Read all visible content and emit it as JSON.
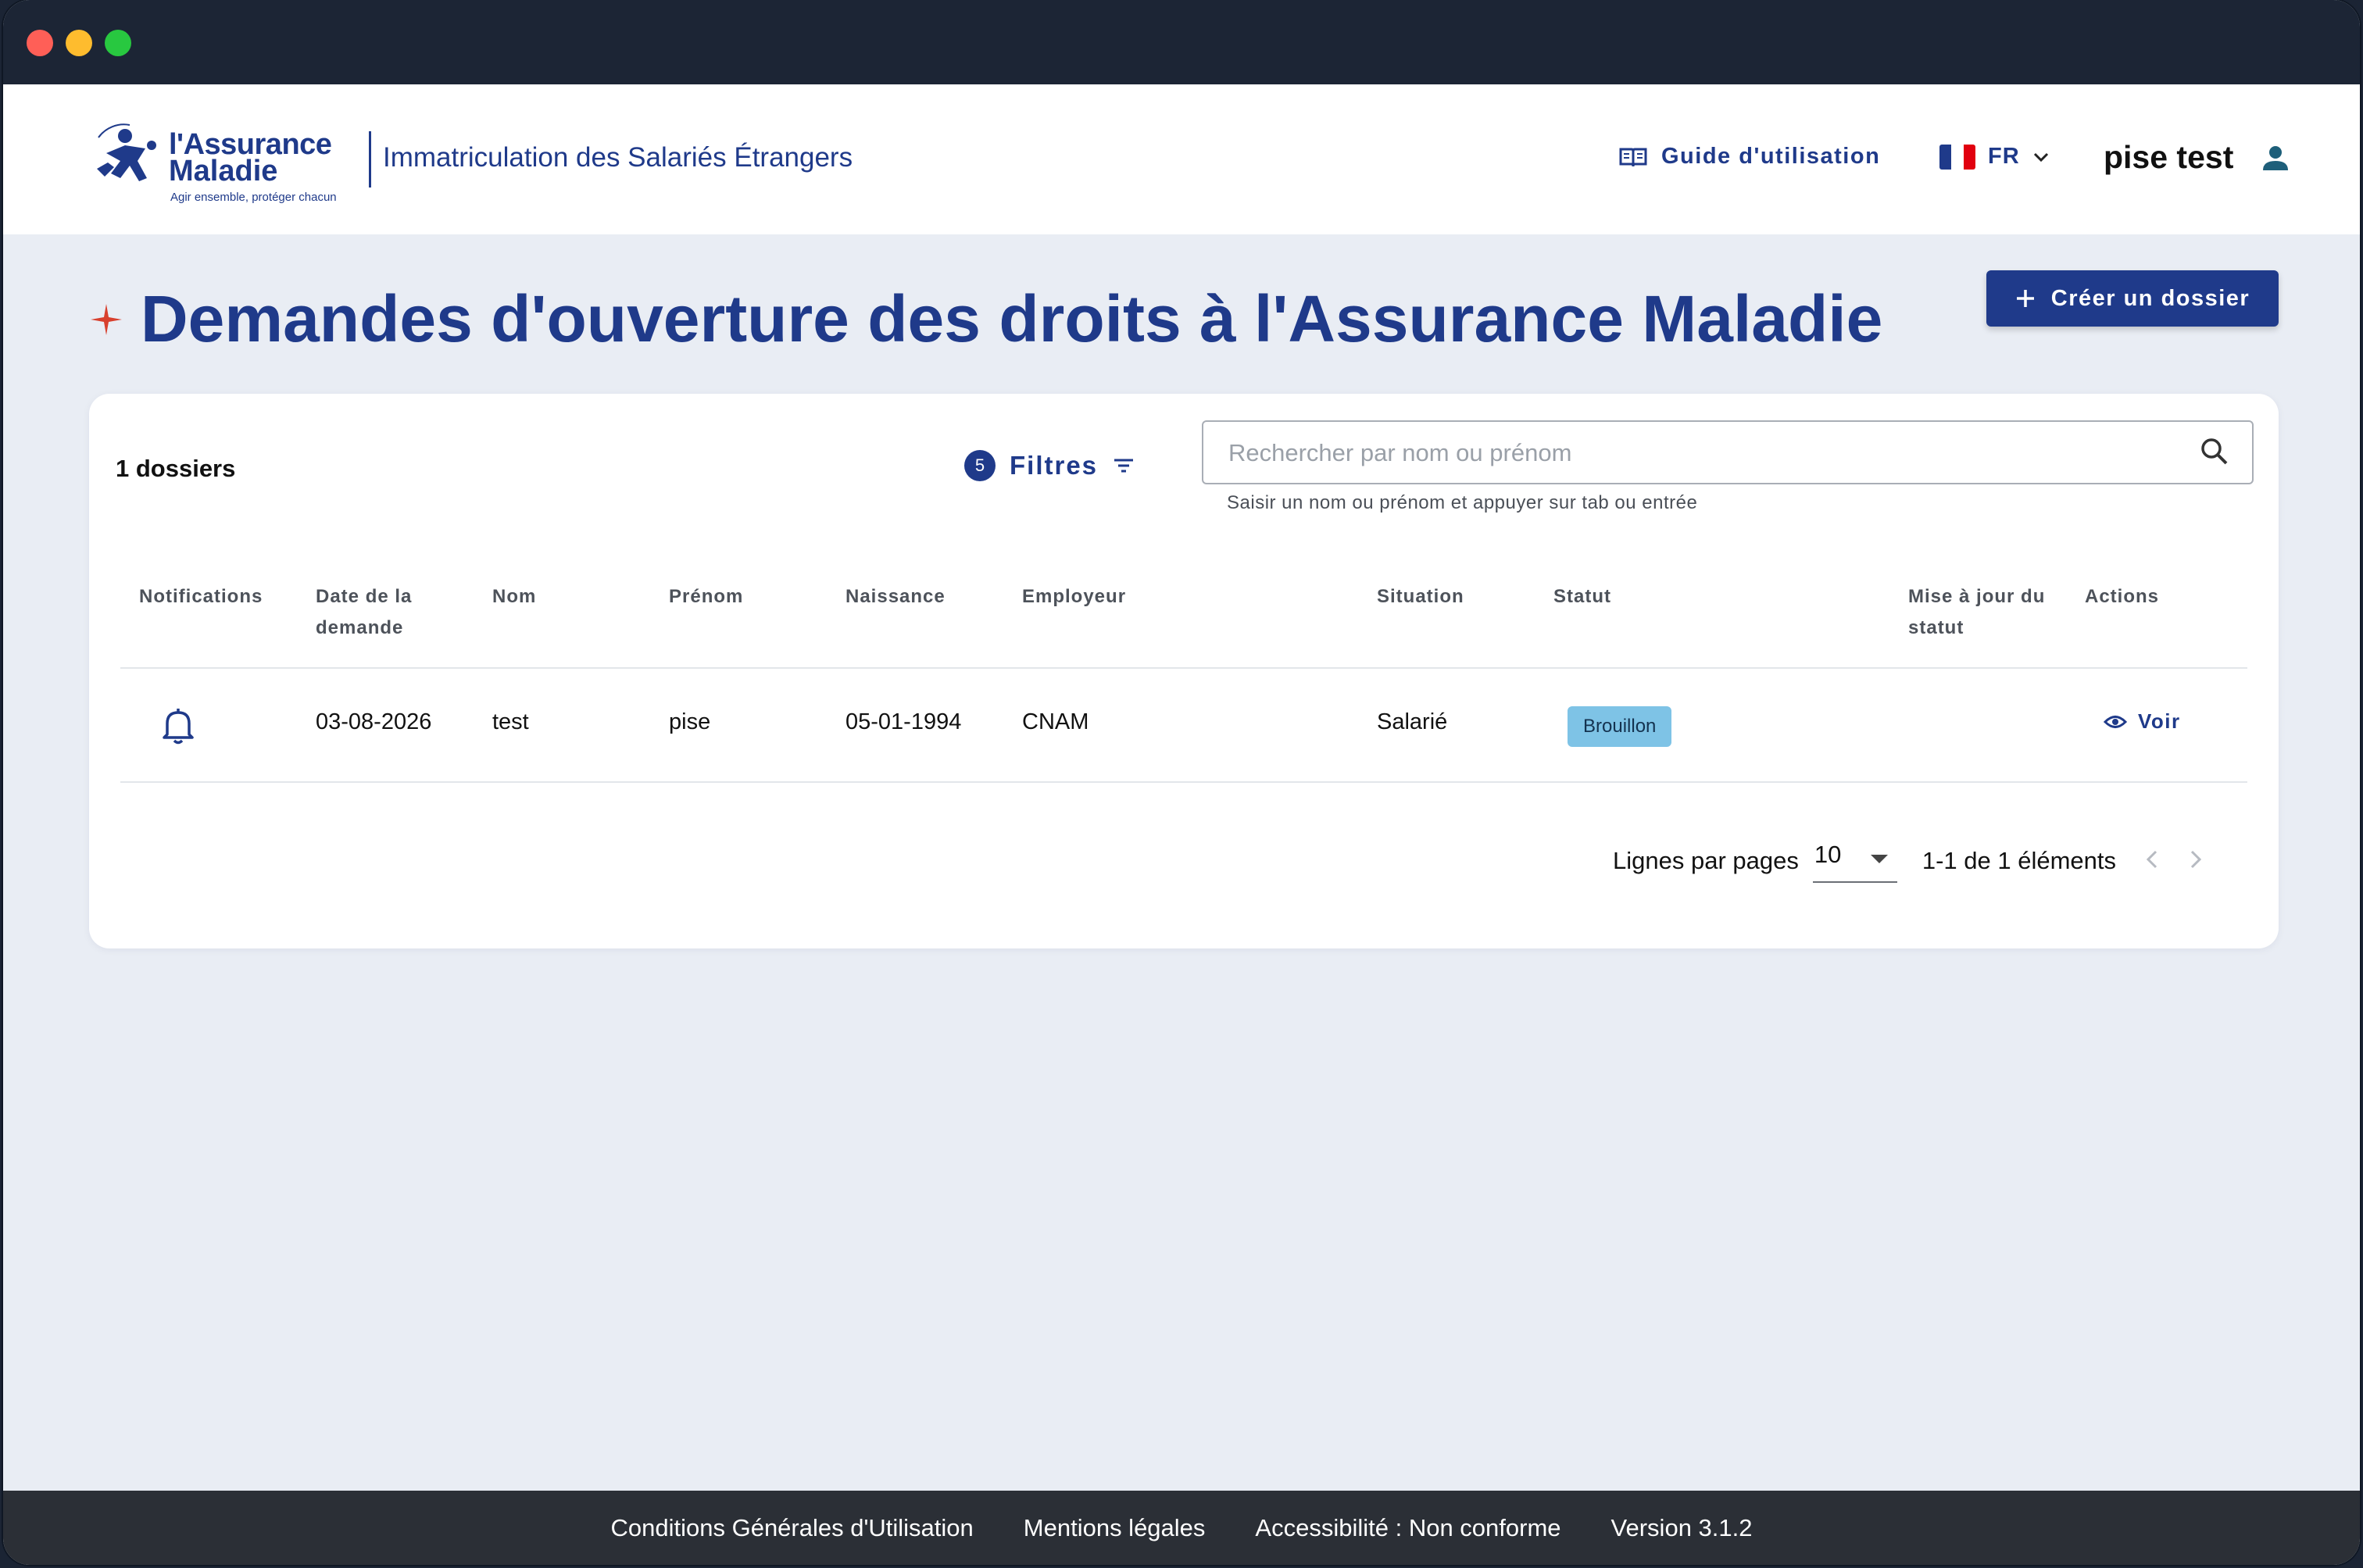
{
  "header": {
    "logo_line1": "l'Assurance",
    "logo_line2": "Maladie",
    "logo_tagline": "Agir ensemble, protéger chacun",
    "app_title": "Immatriculation des Salariés Étrangers",
    "guide_label": "Guide d'utilisation",
    "language": "FR",
    "user_name": "pise test"
  },
  "page": {
    "title": "Demandes d'ouverture des droits à l'Assurance Maladie",
    "create_button": "Créer un dossier",
    "accent_color": "#1f3a8a"
  },
  "list": {
    "count_label": "1 dossiers",
    "filters_count": "5",
    "filters_label": "Filtres",
    "search_placeholder": "Rechercher par nom ou prénom",
    "search_help": "Saisir un nom ou prénom et appuyer sur tab ou entrée",
    "columns": {
      "notifications": "Notifications",
      "date_line1": "Date de la",
      "date_line2": "demande",
      "nom": "Nom",
      "prenom": "Prénom",
      "naissance": "Naissance",
      "employeur": "Employeur",
      "situation": "Situation",
      "statut": "Statut",
      "maj_line1": "Mise à jour du",
      "maj_line2": "statut",
      "actions": "Actions"
    },
    "rows": [
      {
        "notification_icon": "bell-icon",
        "date": "03-08-2026",
        "nom": "test",
        "prenom": "pise",
        "naissance": "05-01-1994",
        "employeur": "CNAM",
        "situation": "Salarié",
        "statut": "Brouillon",
        "maj": "",
        "action": "Voir"
      }
    ],
    "pagination": {
      "rows_label": "Lignes par pages",
      "rows_per_page": "10",
      "range": "1-1 de 1 éléments"
    }
  },
  "footer": {
    "cgu": "Conditions Générales d'Utilisation",
    "mentions": "Mentions légales",
    "accessibility": "Accessibilité : Non conforme",
    "version": "Version 3.1.2"
  }
}
